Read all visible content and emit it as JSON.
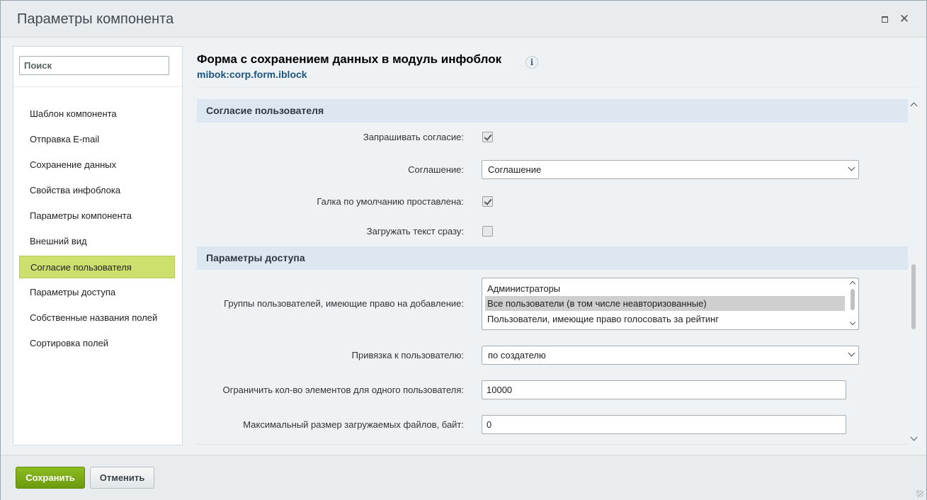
{
  "window": {
    "title": "Параметры компонента",
    "maximize_icon": "maximize-icon",
    "close_icon": "close-icon",
    "close_glyph": "✕"
  },
  "sidebar": {
    "search_placeholder": "Поиск",
    "items": [
      {
        "label": "Шаблон компонента"
      },
      {
        "label": "Отправка E-mail"
      },
      {
        "label": "Сохранение данных"
      },
      {
        "label": "Свойства инфоблока"
      },
      {
        "label": "Параметры компонента"
      },
      {
        "label": "Внешний вид"
      },
      {
        "label": "Согласие пользователя",
        "active": true
      },
      {
        "label": "Параметры доступа"
      },
      {
        "label": "Собственные названия полей"
      },
      {
        "label": "Сортировка полей"
      }
    ]
  },
  "component": {
    "title": "Форма с сохранением данных в модуль инфоблок",
    "info_glyph": "i",
    "code": "mibok:corp.form.iblock"
  },
  "sections": {
    "consent": {
      "title": "Согласие пользователя",
      "request_consent": {
        "label": "Запрашивать согласие:",
        "checked": true
      },
      "agreement": {
        "label": "Соглашение:",
        "value": "Соглашение"
      },
      "default_checked": {
        "label": "Галка по умолчанию проставлена:",
        "checked": true
      },
      "load_text": {
        "label": "Загружать текст сразу:",
        "checked": false
      }
    },
    "access": {
      "title": "Параметры доступа",
      "groups": {
        "label": "Группы пользователей, имеющие право на добавление:",
        "options": [
          {
            "label": "Администраторы",
            "selected": false
          },
          {
            "label": "Все пользователи (в том числе неавторизованные)",
            "selected": true
          },
          {
            "label": "Пользователи, имеющие право голосовать за рейтинг",
            "selected": false
          }
        ]
      },
      "user_binding": {
        "label": "Привязка к пользователю:",
        "value": "по создателю"
      },
      "limit": {
        "label": "Ограничить кол-во элементов для одного пользователя:",
        "value": "10000"
      },
      "max_size": {
        "label": "Максимальный размер загружаемых файлов, байт:",
        "value": "0"
      }
    }
  },
  "footer": {
    "save_label": "Сохранить",
    "cancel_label": "Отменить"
  },
  "colors": {
    "accent_green": "#6c9a0e",
    "active_nav": "#cde06e",
    "section_header_bg": "#dde7f1",
    "code_link": "#1a5581"
  }
}
